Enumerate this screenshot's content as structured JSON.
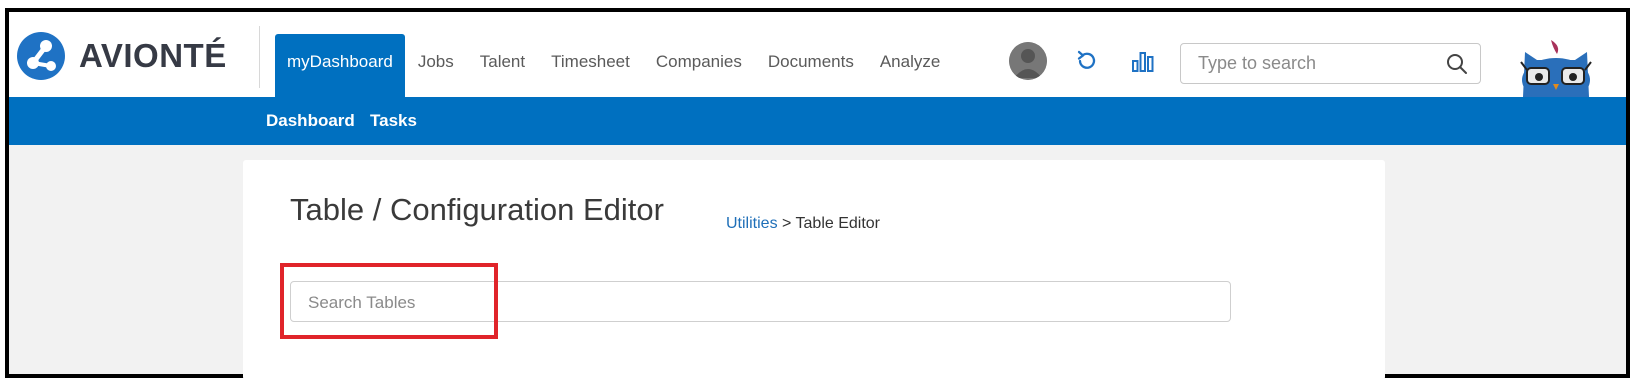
{
  "brand": {
    "name": "AVIONTÉ",
    "accent_color": "#0070c0"
  },
  "nav": {
    "items": [
      {
        "label": "myDashboard",
        "active": true
      },
      {
        "label": "Jobs",
        "active": false
      },
      {
        "label": "Talent",
        "active": false
      },
      {
        "label": "Timesheet",
        "active": false
      },
      {
        "label": "Companies",
        "active": false
      },
      {
        "label": "Documents",
        "active": false
      },
      {
        "label": "Analyze",
        "active": false
      }
    ]
  },
  "header": {
    "search_placeholder": "Type to search",
    "icons": [
      "avatar",
      "refresh-icon",
      "bar-chart-icon",
      "search-icon",
      "owl-mascot"
    ]
  },
  "subnav": {
    "items": [
      {
        "label": "Dashboard"
      },
      {
        "label": "Tasks"
      }
    ]
  },
  "page": {
    "title": "Table / Configuration Editor",
    "breadcrumb": {
      "parent": "Utilities",
      "separator": ">",
      "current": "Table Editor"
    },
    "search_placeholder": "Search Tables"
  },
  "annotation": {
    "highlight_color": "#e0242a"
  }
}
